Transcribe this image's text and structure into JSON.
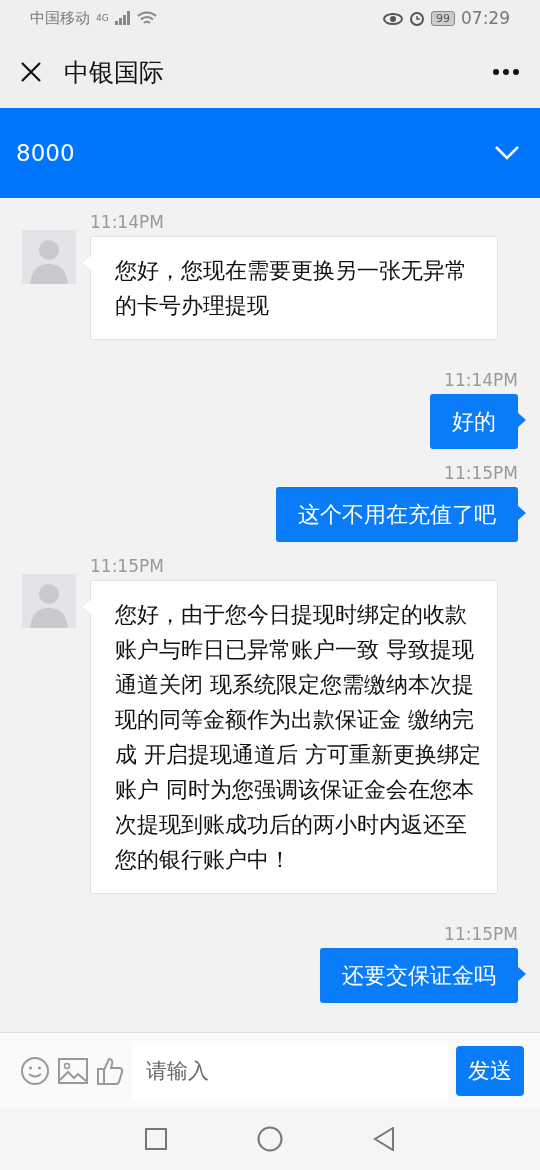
{
  "status_bar": {
    "carrier": "中国移动",
    "network": "4G",
    "battery": "99",
    "time": "07:29"
  },
  "header": {
    "title": "中银国际"
  },
  "amount_bar": {
    "value": "8000",
    "expanded": false
  },
  "messages": [
    {
      "kind": "in",
      "time": "11:14PM",
      "text": "您好，您现在需要更换另一张无异常的卡号办理提现"
    },
    {
      "kind": "out",
      "time": "11:14PM",
      "text": "好的"
    },
    {
      "kind": "out",
      "time": "11:15PM",
      "text": "这个不用在充值了吧"
    },
    {
      "kind": "in",
      "time": "11:15PM",
      "text": "您好，由于您今日提现时绑定的收款账户与昨日已异常账户一致 导致提现通道关闭 现系统限定您需缴纳本次提现的同等金额作为出款保证金 缴纳完成 开启提现通道后 方可重新更换绑定账户 同时为您强调该保证金会在您本次提现到账成功后的两小时内返还至您的银行账户中！"
    },
    {
      "kind": "out",
      "time": "11:15PM",
      "text": "还要交保证金吗"
    }
  ],
  "composer": {
    "placeholder": "请输入",
    "send": "发送"
  }
}
